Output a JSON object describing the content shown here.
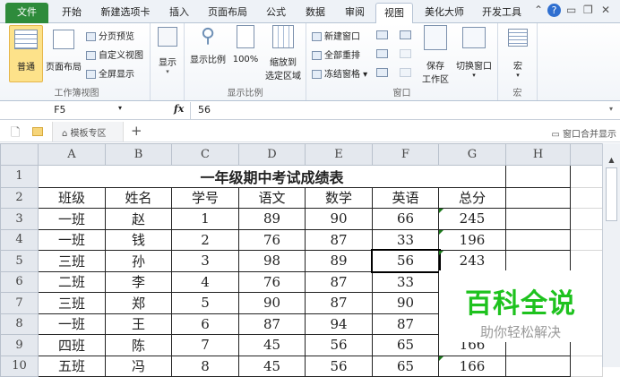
{
  "ribbon_tabs": [
    "文件",
    "开始",
    "新建选项卡",
    "插入",
    "页面布局",
    "公式",
    "数据",
    "审阅",
    "视图",
    "美化大师",
    "开发工具"
  ],
  "active_tab": "视图",
  "groups": {
    "workbook_views": {
      "label": "工作簿视图",
      "normal": "普通",
      "page_layout": "页面布局",
      "page_break": "分页预览",
      "custom_view": "自定义视图",
      "full_screen": "全屏显示"
    },
    "show": {
      "label": "显示"
    },
    "zoom": {
      "label": "显示比例",
      "zoom": "显示比例",
      "hundred": "100%",
      "zoom_sel_1": "缩放到",
      "zoom_sel_2": "选定区域"
    },
    "window": {
      "label": "窗口",
      "new_window": "新建窗口",
      "arrange_all": "全部重排",
      "freeze": "冻结窗格",
      "save_ws_1": "保存",
      "save_ws_2": "工作区",
      "switch": "切换窗口"
    },
    "macro": {
      "label": "宏",
      "macro": "宏"
    }
  },
  "formula_bar": {
    "name_box": "F5",
    "fx": "fx",
    "value": "56"
  },
  "doc_tabs": {
    "template": "模板专区",
    "add": "+",
    "merge": "窗口合并显示"
  },
  "columns": [
    "A",
    "B",
    "C",
    "D",
    "E",
    "F",
    "G",
    "H"
  ],
  "rows": [
    "1",
    "2",
    "3",
    "4",
    "5",
    "6",
    "7",
    "8",
    "9",
    "10"
  ],
  "title": "一年级期中考试成绩表",
  "headers": [
    "班级",
    "姓名",
    "学号",
    "语文",
    "数学",
    "英语",
    "总分"
  ],
  "data": [
    [
      "一班",
      "赵",
      "1",
      "89",
      "90",
      "66",
      "245"
    ],
    [
      "一班",
      "钱",
      "2",
      "76",
      "87",
      "33",
      "196"
    ],
    [
      "三班",
      "孙",
      "3",
      "98",
      "89",
      "56",
      "243"
    ],
    [
      "二班",
      "李",
      "4",
      "76",
      "87",
      "33",
      ""
    ],
    [
      "三班",
      "郑",
      "5",
      "90",
      "87",
      "90",
      ""
    ],
    [
      "一班",
      "王",
      "6",
      "87",
      "94",
      "87",
      ""
    ],
    [
      "四班",
      "陈",
      "7",
      "45",
      "56",
      "65",
      "166"
    ],
    [
      "五班",
      "冯",
      "8",
      "45",
      "56",
      "65",
      "166"
    ]
  ],
  "watermark": {
    "title": "百科全说",
    "subtitle": "助你轻松解决"
  }
}
